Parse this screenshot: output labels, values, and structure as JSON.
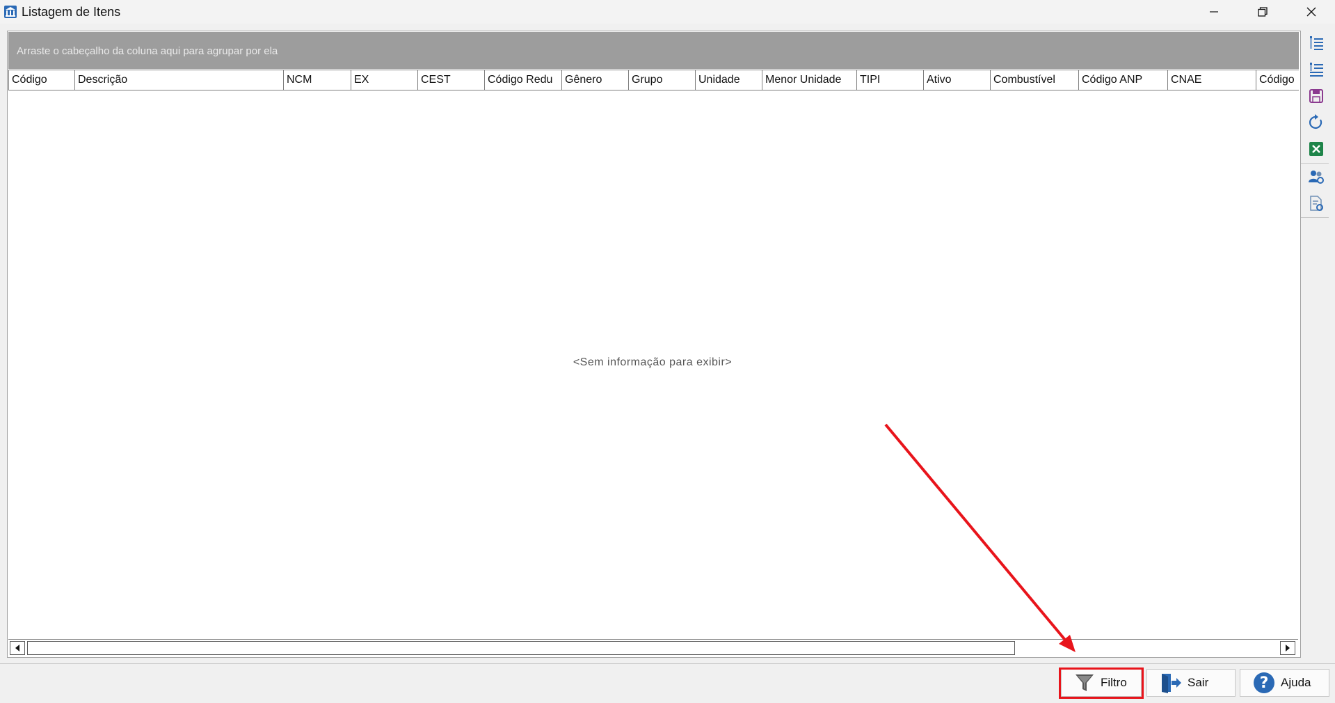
{
  "window": {
    "title": "Listagem de Itens",
    "controls": [
      "minimize",
      "restore",
      "close"
    ]
  },
  "grid": {
    "group_hint": "Arraste o cabeçalho da coluna aqui para agrupar por ela",
    "columns": [
      "Código",
      "Descrição",
      "NCM",
      "EX",
      "CEST",
      "Código Redu",
      "Gênero",
      "Grupo",
      "Unidade",
      "Menor Unidade",
      "TIPI",
      "Ativo",
      "Combustível",
      "Código ANP",
      "CNAE",
      "Código"
    ],
    "empty_text": "<Sem informação para exibir>"
  },
  "side_toolbar": {
    "icons": [
      "expand-tree-icon",
      "collapse-tree-icon",
      "save-layout-icon",
      "refresh-icon",
      "excel-export-icon",
      "users-settings-icon",
      "report-settings-icon"
    ]
  },
  "buttons": {
    "filter_label": "Filtro",
    "exit_label": "Sair",
    "help_label": "Ajuda"
  },
  "colors": {
    "highlight": "#e8141b",
    "group_bar": "#9d9d9d",
    "icon_blue": "#2a69b5"
  }
}
